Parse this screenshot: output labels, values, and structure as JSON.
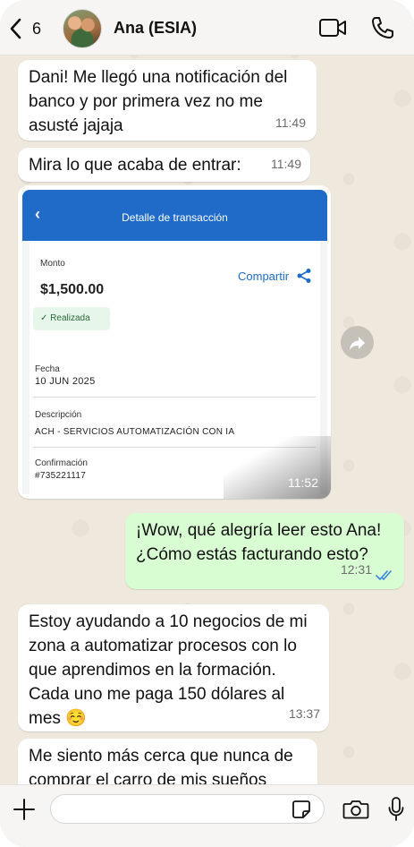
{
  "header": {
    "back_count": "6",
    "contact_name": "Ana (ESIA)"
  },
  "messages": [
    {
      "direction": "in",
      "text": "Dani! Me llegó una notificación del\nbanco y por primera vez no me\nasusté jajaja",
      "time": "11:49"
    },
    {
      "direction": "in",
      "text": "Mira lo que acaba de entrar:",
      "time": "11:49"
    },
    {
      "direction": "out",
      "text": "¡Wow, qué alegría leer esto Ana!\n¿Cómo estás facturando esto?",
      "time": "12:31",
      "status": "read"
    },
    {
      "direction": "in",
      "text": "Estoy ayudando a 10 negocios de mi\nzona a automatizar procesos con lo\nque aprendimos en la formación.\nCada uno me paga 150 dólares al\nmes ☺️",
      "time": "13:37"
    },
    {
      "direction": "in",
      "text": "Me siento más cerca que nunca de\ncomprar el carro de mis sueños",
      "time": ""
    }
  ],
  "image_message": {
    "time": "11:52",
    "card": {
      "title": "Detalle de transacción",
      "amount_label": "Monto",
      "amount": "$1,500.00",
      "share_label": "Compartir",
      "status": "✓ Realizada",
      "date_label": "Fecha",
      "date": "10 JUN 2025",
      "description_label": "Descripción",
      "description": "ACH - SERVICIOS AUTOMATIZACIÓN CON IA",
      "confirmation_label": "Confirmación",
      "confirmation": "#735221117"
    }
  },
  "input": {
    "placeholder": ""
  },
  "colors": {
    "outgoing_bubble": "#d9fdd3",
    "incoming_bubble": "#ffffff",
    "bank_header": "#1f6bc7",
    "read_ticks": "#3c86e0"
  }
}
